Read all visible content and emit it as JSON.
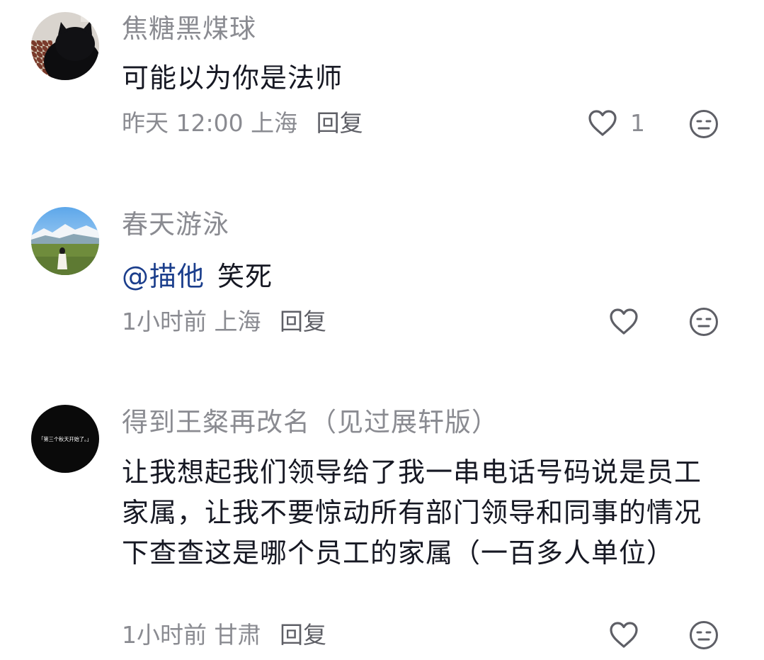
{
  "comments": [
    {
      "username": "焦糖黑煤球",
      "text": "可能以为你是法师",
      "time": "昨天 12:00",
      "location": "上海",
      "reply_label": "回复",
      "like_count": "1",
      "avatar_icon": "black-cat-avatar"
    },
    {
      "username": "春天游泳",
      "mention": "@描他",
      "text": "笑死",
      "time": "1小时前",
      "location": "上海",
      "reply_label": "回复",
      "avatar_icon": "mountain-landscape-avatar"
    },
    {
      "username": "得到王粲再改名（见过展轩版）",
      "text": "让我想起我们领导给了我一串电话号码说是员工家属，让我不要惊动所有部门领导和同事的情况下查查这是哪个员工的家属（一百多人单位）",
      "time": "1小时前",
      "location": "甘肃",
      "reply_label": "回复",
      "avatar_text": "「第三个秋天开始了。」",
      "avatar_icon": "black-text-avatar"
    }
  ],
  "colors": {
    "username": "#8a8b91",
    "text": "#161823",
    "mention": "#1b3e8c",
    "meta": "#8a8b91",
    "icon": "#5e5f66"
  }
}
